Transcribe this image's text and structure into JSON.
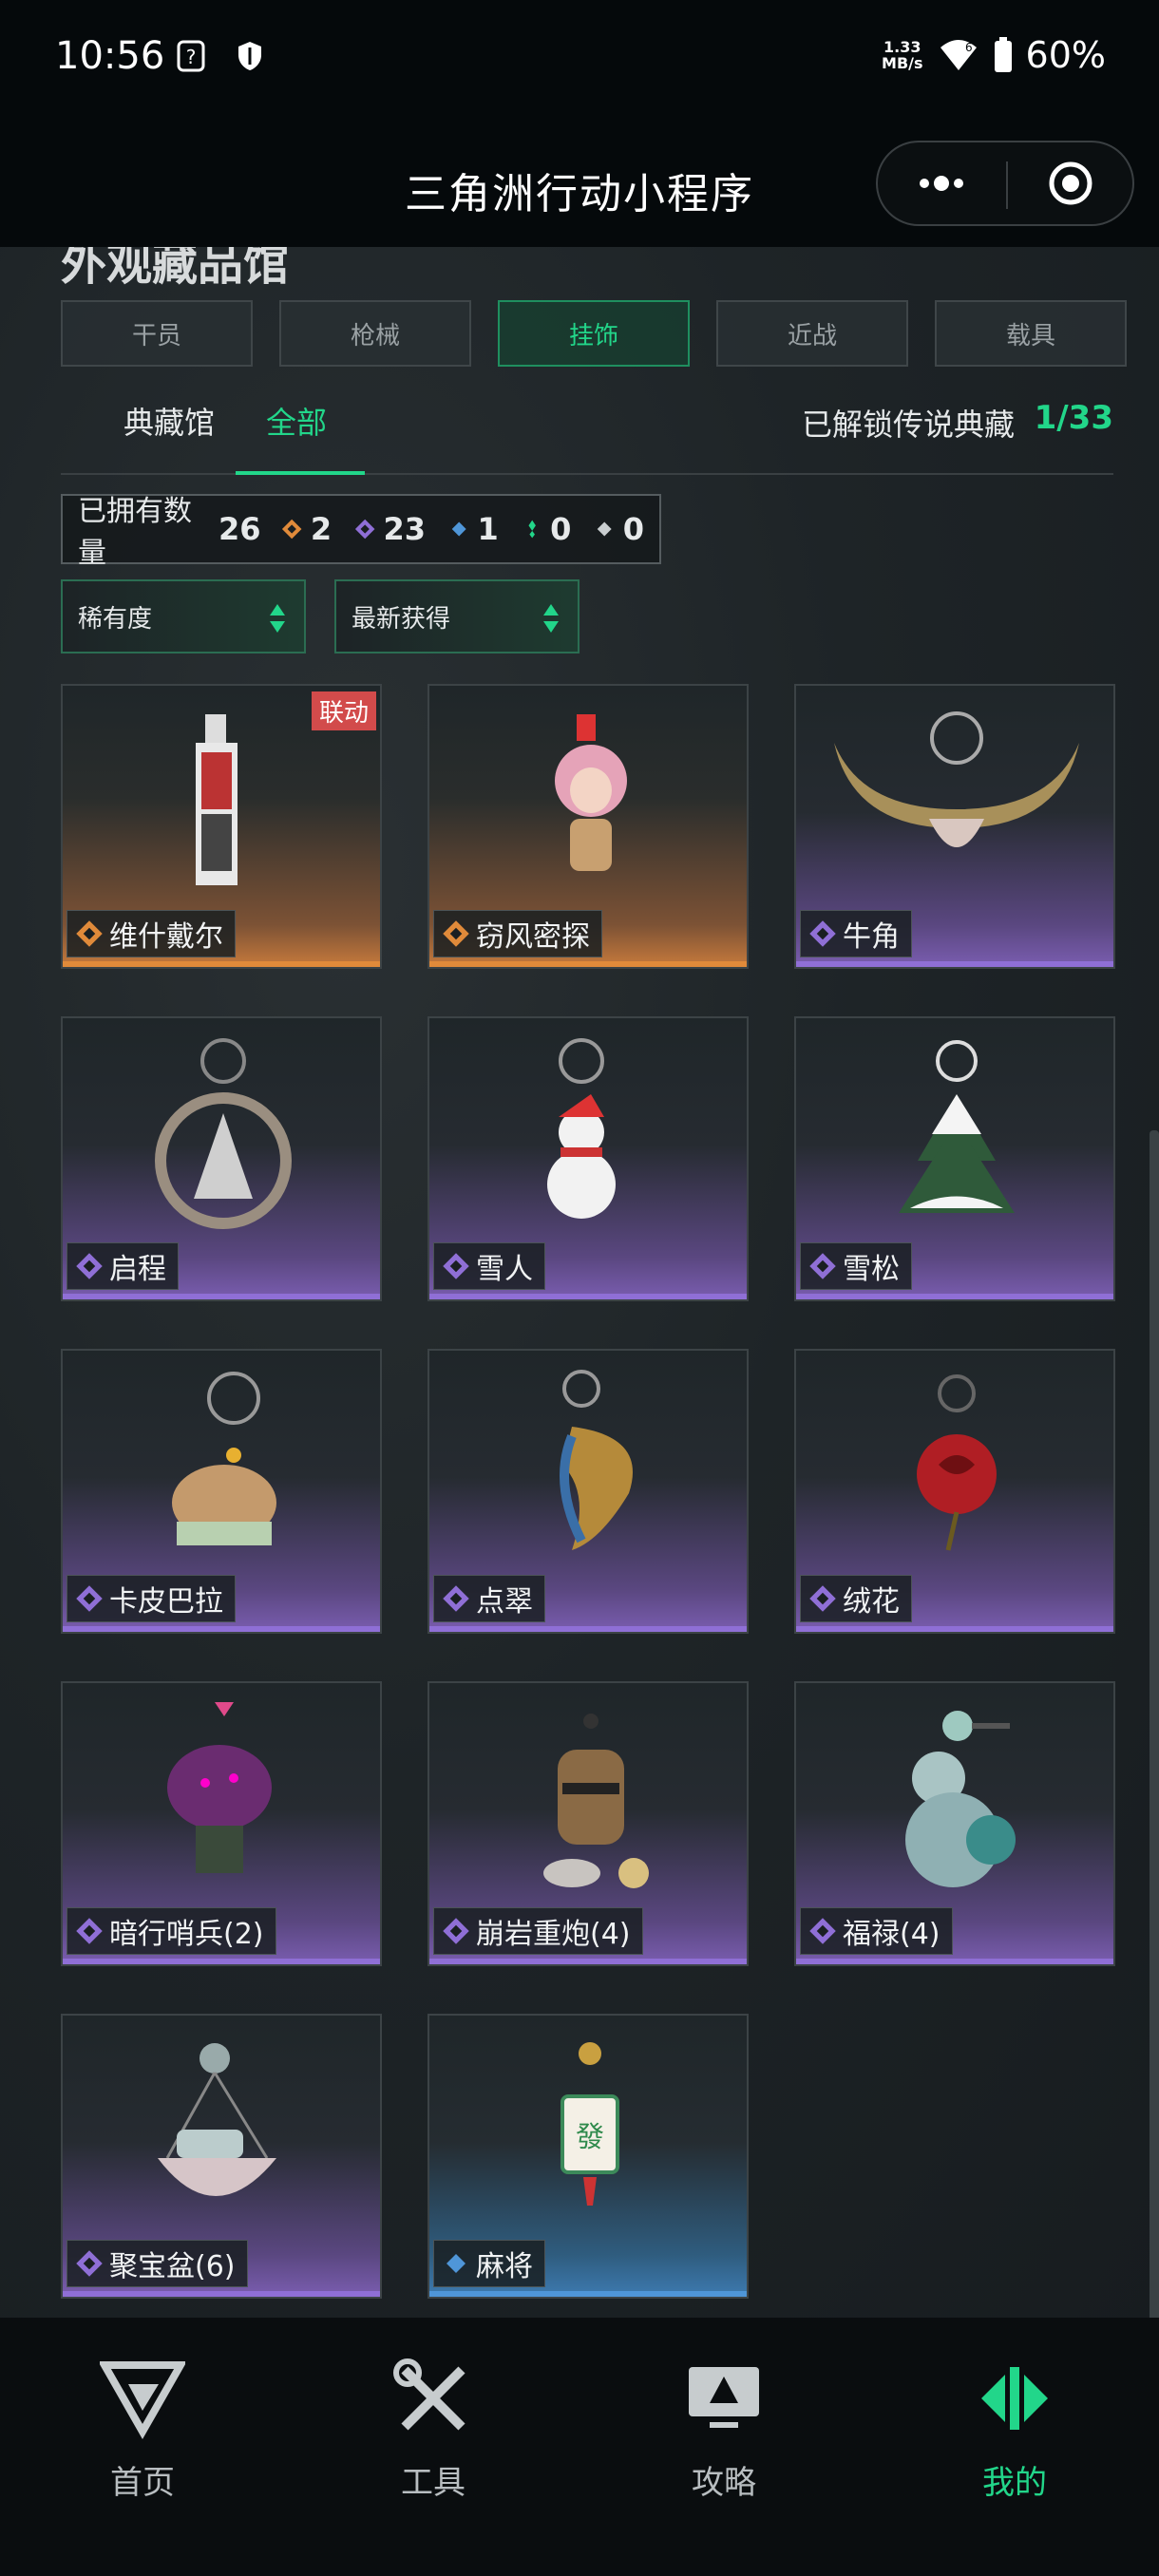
{
  "status_bar": {
    "time": "10:56",
    "speed_value": "1.33",
    "speed_unit": "MB/s",
    "battery": "60%"
  },
  "title_bar": {
    "title": "三角洲行动小程序"
  },
  "section": {
    "title": "外观藏品馆"
  },
  "category_tabs": [
    "干员",
    "枪械",
    "挂饰",
    "近战",
    "载具"
  ],
  "active_category": "挂饰",
  "sub_tabs": {
    "collection": "典藏馆",
    "all": "全部",
    "legend_label": "已解锁传说典藏",
    "legend_count": "1/33"
  },
  "owned": {
    "label": "已拥有数量",
    "total": "26",
    "gold": "2",
    "purple": "23",
    "blue": "1",
    "green": "0",
    "white": "0"
  },
  "filters": {
    "rarity": "稀有度",
    "sort": "最新获得"
  },
  "items": [
    {
      "name": "维什戴尔",
      "rarity": "gold",
      "badge": "联动",
      "icon": "card-keychain"
    },
    {
      "name": "窃风密探",
      "rarity": "gold",
      "icon": "girl-figure-charm"
    },
    {
      "name": "牛角",
      "rarity": "purple",
      "icon": "bull-horn-charm"
    },
    {
      "name": "启程",
      "rarity": "purple",
      "icon": "anniversary-medal-charm"
    },
    {
      "name": "雪人",
      "rarity": "purple",
      "icon": "snowman-charm"
    },
    {
      "name": "雪松",
      "rarity": "purple",
      "icon": "snow-pine-charm"
    },
    {
      "name": "卡皮巴拉",
      "rarity": "purple",
      "icon": "capybara-charm"
    },
    {
      "name": "点翠",
      "rarity": "purple",
      "icon": "phoenix-charm"
    },
    {
      "name": "绒花",
      "rarity": "purple",
      "icon": "red-rose-charm"
    },
    {
      "name": "暗行哨兵(2)",
      "rarity": "purple",
      "icon": "snake-soldier-charm"
    },
    {
      "name": "崩岩重炮(4)",
      "rarity": "purple",
      "icon": "rock-creature-charm"
    },
    {
      "name": "福禄(4)",
      "rarity": "purple",
      "icon": "gourd-charm"
    },
    {
      "name": "聚宝盆(6)",
      "rarity": "purple",
      "icon": "treasure-bowl-charm"
    },
    {
      "name": "麻将",
      "rarity": "blue",
      "icon": "mahjong-tile-charm"
    }
  ],
  "nav": [
    {
      "label": "首页",
      "icon": "delta-home-icon"
    },
    {
      "label": "工具",
      "icon": "tools-icon"
    },
    {
      "label": "攻略",
      "icon": "guide-monitor-icon"
    },
    {
      "label": "我的",
      "icon": "profile-logo-icon",
      "active": true
    }
  ],
  "colors": {
    "accent": "#22d68a",
    "gold": "#e08a3a",
    "purple": "#8f6fd6",
    "blue": "#4f96d8",
    "badge": "#d24b4b"
  }
}
